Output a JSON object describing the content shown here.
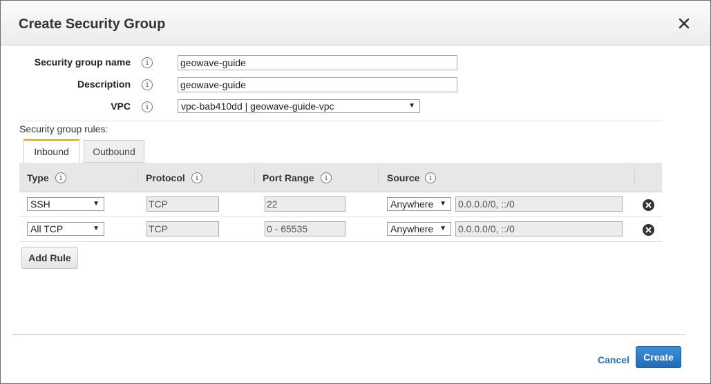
{
  "dialog": {
    "title": "Create Security Group",
    "close_icon": "close-icon"
  },
  "form": {
    "name_label": "Security group name",
    "name_value": "geowave-guide",
    "description_label": "Description",
    "description_value": "geowave-guide",
    "vpc_label": "VPC",
    "vpc_value": "vpc-bab410dd | geowave-guide-vpc",
    "info_glyph": "i"
  },
  "rules": {
    "section_label": "Security group rules:",
    "tabs": [
      {
        "label": "Inbound",
        "active": true
      },
      {
        "label": "Outbound",
        "active": false
      }
    ],
    "columns": [
      "Type",
      "Protocol",
      "Port Range",
      "Source"
    ],
    "rows": [
      {
        "type": "SSH",
        "protocol": "TCP",
        "port_range": "22",
        "source": "Anywhere",
        "cidr": "0.0.0.0/0, ::/0"
      },
      {
        "type": "All TCP",
        "protocol": "TCP",
        "port_range": "0 - 65535",
        "source": "Anywhere",
        "cidr": "0.0.0.0/0, ::/0"
      }
    ],
    "add_rule_label": "Add Rule"
  },
  "footer": {
    "cancel_label": "Cancel",
    "create_label": "Create"
  },
  "colors": {
    "accent_tab": "#e8a000",
    "primary_button": "#2f7fcc",
    "link": "#2a6fb6"
  }
}
